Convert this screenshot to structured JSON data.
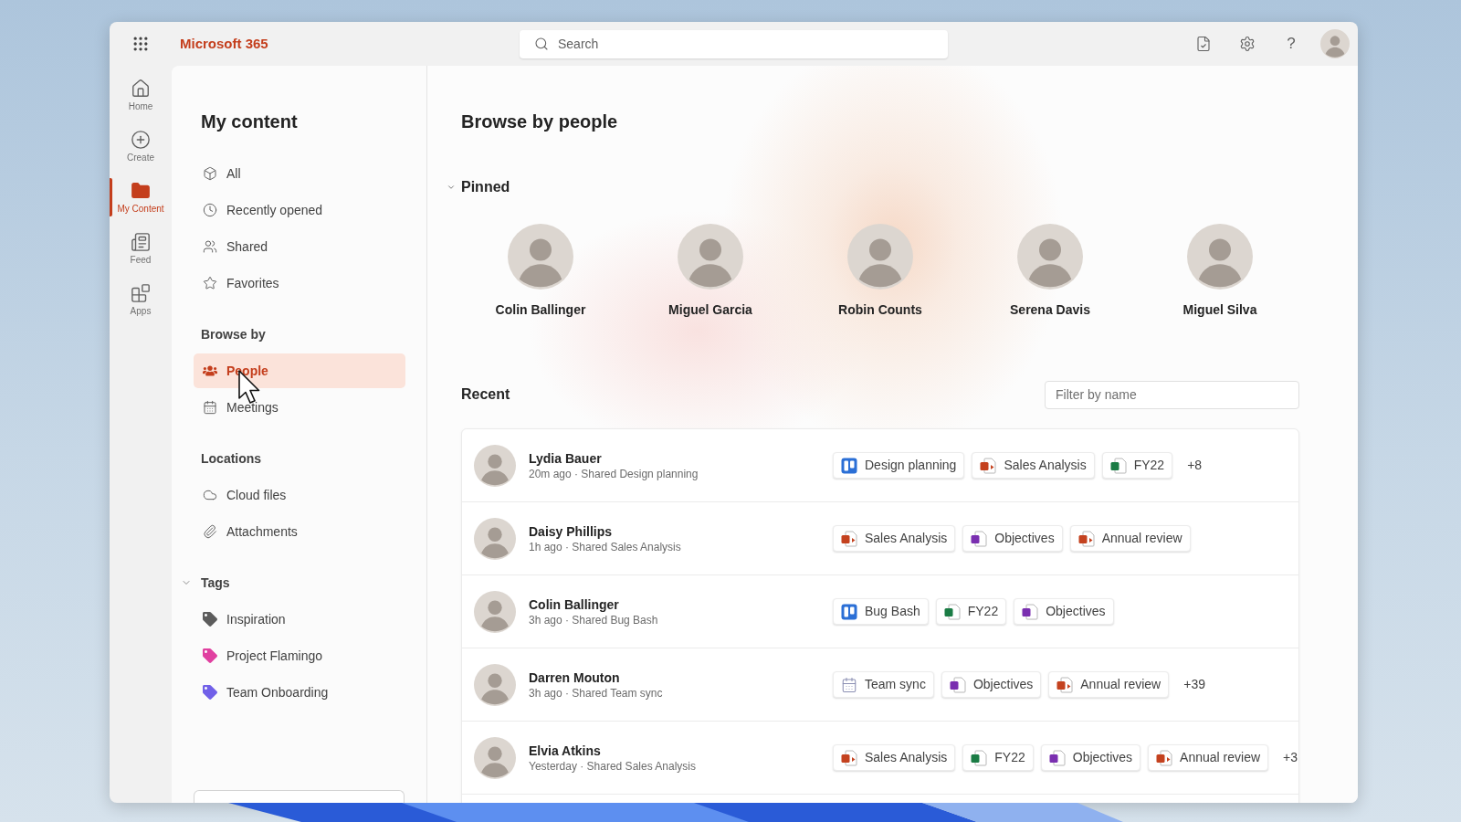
{
  "app": {
    "title": "Microsoft 365",
    "help_label": "?"
  },
  "search": {
    "placeholder": "Search"
  },
  "rail": [
    {
      "label": "Home",
      "selected": false
    },
    {
      "label": "Create",
      "selected": false
    },
    {
      "label": "My Content",
      "selected": true
    },
    {
      "label": "Feed",
      "selected": false
    },
    {
      "label": "Apps",
      "selected": false
    }
  ],
  "nav": {
    "title": "My content",
    "groups": [
      {
        "items": [
          {
            "label": "All",
            "selected": false
          },
          {
            "label": "Recently opened",
            "selected": false
          },
          {
            "label": "Shared",
            "selected": false
          },
          {
            "label": "Favorites",
            "selected": false
          }
        ]
      },
      {
        "heading": "Browse by",
        "items": [
          {
            "label": "People",
            "selected": true
          },
          {
            "label": "Meetings",
            "selected": false
          }
        ]
      },
      {
        "heading": "Locations",
        "items": [
          {
            "label": "Cloud files",
            "selected": false
          },
          {
            "label": "Attachments",
            "selected": false
          }
        ]
      },
      {
        "heading": "Tags",
        "expanded": true,
        "items": [
          {
            "label": "Inspiration",
            "color": "#5c5c5c",
            "selected": false
          },
          {
            "label": "Project Flamingo",
            "color": "#e040a0",
            "selected": false
          },
          {
            "label": "Team Onboarding",
            "color": "#7160e8",
            "selected": false
          }
        ]
      }
    ]
  },
  "main": {
    "title": "Browse by people",
    "pinned": {
      "label": "Pinned",
      "expanded": true,
      "people": [
        {
          "name": "Colin Ballinger"
        },
        {
          "name": "Miguel Garcia"
        },
        {
          "name": "Robin Counts"
        },
        {
          "name": "Serena Davis"
        },
        {
          "name": "Miguel Silva"
        }
      ]
    },
    "recent": {
      "label": "Recent",
      "filter": {
        "placeholder": "Filter by name"
      },
      "rows": [
        {
          "name": "Lydia Bauer",
          "activity": "20m ago · Shared Design planning",
          "files": [
            {
              "kind": "board",
              "label": "Design planning"
            },
            {
              "kind": "powerpoint",
              "label": "Sales Analysis"
            },
            {
              "kind": "excel",
              "label": "FY22"
            }
          ],
          "more": "+8"
        },
        {
          "name": "Daisy Phillips",
          "activity": "1h ago · Shared Sales Analysis",
          "files": [
            {
              "kind": "powerpoint",
              "label": "Sales Analysis"
            },
            {
              "kind": "onenote",
              "label": "Objectives"
            },
            {
              "kind": "powerpoint",
              "label": "Annual review"
            }
          ]
        },
        {
          "name": "Colin Ballinger",
          "activity": "3h ago · Shared Bug Bash",
          "files": [
            {
              "kind": "board",
              "label": "Bug Bash"
            },
            {
              "kind": "excel",
              "label": "FY22"
            },
            {
              "kind": "onenote",
              "label": "Objectives"
            }
          ]
        },
        {
          "name": "Darren Mouton",
          "activity": "3h ago · Shared Team sync",
          "files": [
            {
              "kind": "meeting",
              "label": "Team sync"
            },
            {
              "kind": "onenote",
              "label": "Objectives"
            },
            {
              "kind": "powerpoint",
              "label": "Annual review"
            }
          ],
          "more": "+39"
        },
        {
          "name": "Elvia Atkins",
          "activity": "Yesterday · Shared Sales Analysis",
          "files": [
            {
              "kind": "powerpoint",
              "label": "Sales Analysis"
            },
            {
              "kind": "excel",
              "label": "FY22"
            },
            {
              "kind": "onenote",
              "label": "Objectives"
            },
            {
              "kind": "powerpoint",
              "label": "Annual review"
            }
          ],
          "more": "+3"
        }
      ]
    }
  }
}
